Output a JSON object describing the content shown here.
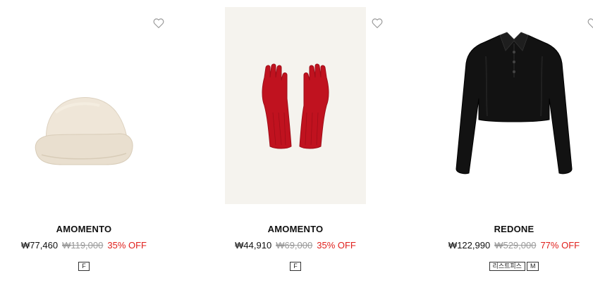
{
  "products": [
    {
      "brand": "AMOMENTO",
      "price": "₩77,460",
      "original_price": "₩119,000",
      "discount": "35% OFF",
      "tags": [
        "F"
      ],
      "image": "cream-knit-bucket-hat",
      "wishlist_icon": "heart-outline-icon"
    },
    {
      "brand": "AMOMENTO",
      "price": "₩44,910",
      "original_price": "₩69,000",
      "discount": "35% OFF",
      "tags": [
        "F"
      ],
      "image": "red-knit-gloves",
      "wishlist_icon": "heart-outline-icon"
    },
    {
      "brand": "REDONE",
      "price": "₩122,990",
      "original_price": "₩529,000",
      "discount": "77% OFF",
      "tags": [
        "리스트피스",
        "M"
      ],
      "image": "black-velour-cropped-polo",
      "wishlist_icon": "heart-outline-icon"
    }
  ],
  "colors": {
    "discount": "#e0201c",
    "original_price": "#999999",
    "image_bg_gloves": "#f5f3ee",
    "hat": "#efe6d8",
    "gloves": "#c0121f",
    "top": "#121212"
  }
}
